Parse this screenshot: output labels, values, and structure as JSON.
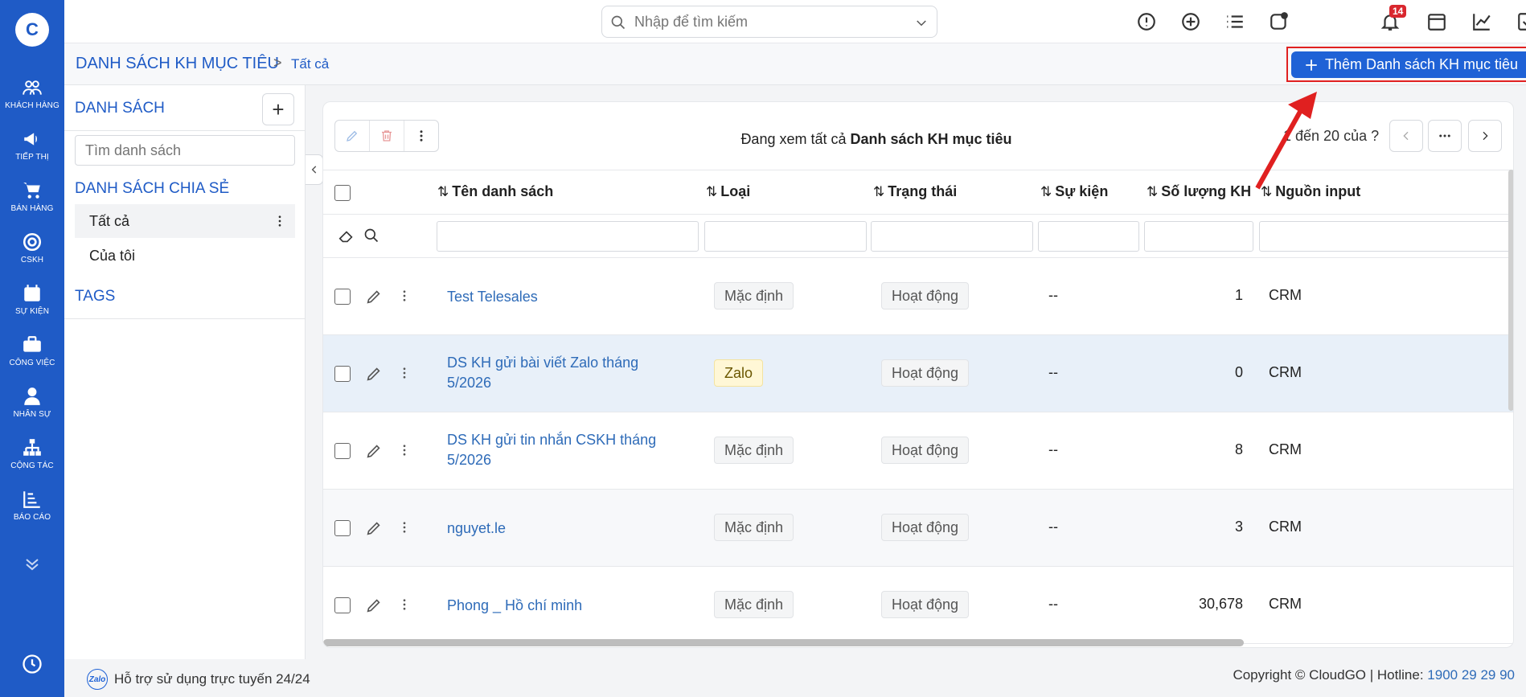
{
  "nav": {
    "logo_text": "C",
    "items": [
      {
        "label": "KHÁCH HÀNG",
        "icon": "users-icon"
      },
      {
        "label": "TIẾP THỊ",
        "icon": "megaphone-icon"
      },
      {
        "label": "BÁN HÀNG",
        "icon": "cart-icon"
      },
      {
        "label": "CSKH",
        "icon": "lifebuoy-icon"
      },
      {
        "label": "SỰ KIỆN",
        "icon": "calendar-icon"
      },
      {
        "label": "CÔNG VIỆC",
        "icon": "briefcase-icon"
      },
      {
        "label": "NHÂN SỰ",
        "icon": "person-icon"
      },
      {
        "label": "CỘNG TÁC",
        "icon": "org-chart-icon"
      },
      {
        "label": "BÁO CÁO",
        "icon": "report-icon"
      }
    ]
  },
  "topbar": {
    "search_placeholder": "Nhập để tìm kiếm",
    "notification_count": "14"
  },
  "breadcrumb": {
    "title": "DANH SÁCH KH MỤC TIÊU",
    "separator": ">",
    "current": "Tất cả",
    "add_button": "Thêm Danh sách KH mục tiêu"
  },
  "sidebar": {
    "section_list": "DANH SÁCH",
    "search_placeholder": "Tìm danh sách",
    "section_shared": "DANH SÁCH CHIA SẺ",
    "items": [
      "Tất cả",
      "Của tôi"
    ],
    "section_tags": "TAGS"
  },
  "main": {
    "viewing_prefix": "Đang xem tất cả",
    "viewing_entity": "Danh sách KH mục tiêu",
    "pager_text": "1 đến 20 của ?",
    "columns": [
      "Tên danh sách",
      "Loại",
      "Trạng thái",
      "Sự kiện",
      "Số lượng KH",
      "Nguồn input"
    ],
    "rows": [
      {
        "name": "Test Telesales",
        "type": "Mặc định",
        "status": "Hoạt động",
        "event": "--",
        "count": "1",
        "source": "CRM"
      },
      {
        "name": "DS KH gửi bài viết Zalo tháng 5/2026",
        "type": "Zalo",
        "status": "Hoạt động",
        "event": "--",
        "count": "0",
        "source": "CRM"
      },
      {
        "name": "DS KH gửi tin nhắn CSKH tháng 5/2026",
        "type": "Mặc định",
        "status": "Hoạt động",
        "event": "--",
        "count": "8",
        "source": "CRM"
      },
      {
        "name": "nguyet.le",
        "type": "Mặc định",
        "status": "Hoạt động",
        "event": "--",
        "count": "3",
        "source": "CRM"
      },
      {
        "name": "Phong _ Hồ chí minh",
        "type": "Mặc định",
        "status": "Hoạt động",
        "event": "--",
        "count": "30,678",
        "source": "CRM"
      }
    ]
  },
  "footer": {
    "zalo_label": "Zalo",
    "support": "Hỗ trợ sử dụng trực tuyến 24/24",
    "copyright": "Copyright © CloudGO",
    "hotline_label": "Hotline:",
    "hotline": "1900 29 29 90"
  },
  "colors": {
    "brand": "#1f5bc6",
    "accent_button": "#1f62d6",
    "highlight_box": "#e02020"
  }
}
